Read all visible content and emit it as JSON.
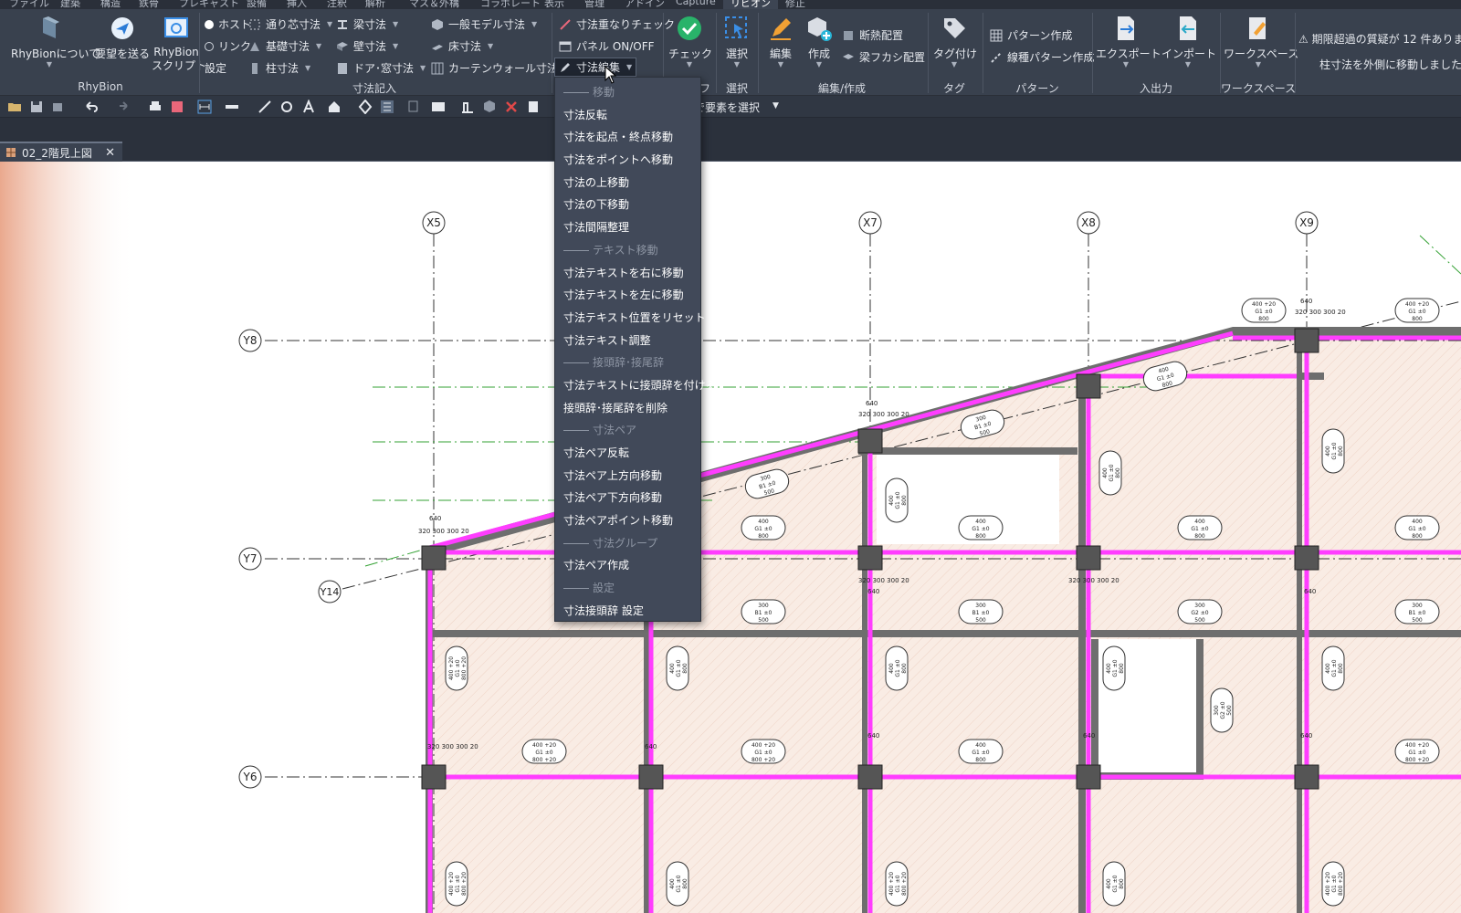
{
  "menu": [
    "ファイル",
    "建築",
    "構造",
    "鉄骨",
    "プレキャスト",
    "設備",
    "挿入",
    "注釈",
    "解析",
    "マス＆外構",
    "コラボレート",
    "表示",
    "管理",
    "アドイン",
    "Capture",
    "リビオン",
    "修正"
  ],
  "ribbon": {
    "rhybion": {
      "about": "RhyBionについて",
      "feedback": "要望を送る",
      "script_line1": "RhyBion",
      "script_line2": "スクリプト",
      "group": "RhyBion"
    },
    "dims": {
      "host": "ホスト",
      "link": "リンク",
      "setting": "設定",
      "grid_dim": "通り芯寸法",
      "found_dim": "基礎寸法",
      "col_dim": "柱寸法",
      "beam_dim": "梁寸法",
      "wall_dim": "壁寸法",
      "door_dim": "ドア･窓寸法",
      "model_dim": "一般モデル寸法",
      "floor_dim": "床寸法",
      "cw_dim": "カーテンウォール寸法",
      "group": "寸法記入"
    },
    "check_tools": {
      "overlap": "寸法重なりチェック",
      "panel": "パネル ON/OFF",
      "edit": "寸法編集",
      "group_tail": "フ"
    },
    "check": {
      "label": "チェック"
    },
    "select": {
      "label": "選択",
      "group": "選択"
    },
    "edit_create": {
      "edit": "編集",
      "create": "作成",
      "insulation": "断熱配置",
      "haunch": "梁フカシ配置",
      "group": "編集/作成"
    },
    "tag": {
      "label": "タグ付け",
      "group": "タグ"
    },
    "pattern": {
      "create": "パターン作成",
      "line": "線種パターン作成",
      "group": "パターン"
    },
    "io": {
      "export": "エクスポート",
      "import": "インポート",
      "group": "入出力"
    },
    "workspace": {
      "label": "ワークスペース",
      "group": "ワークスペース"
    }
  },
  "notice": {
    "line1": "⚠ 期限超過の質疑が 12 件あります",
    "line2": "柱寸法を外側に移動しました。反"
  },
  "qat": {
    "select_text": "で要素を選択"
  },
  "doc_tab": {
    "name": "02_2階見上図",
    "close": "✕"
  },
  "dropdown": [
    {
      "type": "section",
      "label": "移動"
    },
    {
      "type": "item",
      "label": "寸法反転"
    },
    {
      "type": "item",
      "label": "寸法を起点・終点移動"
    },
    {
      "type": "item",
      "label": "寸法をポイントへ移動"
    },
    {
      "type": "item",
      "label": "寸法の上移動"
    },
    {
      "type": "item",
      "label": "寸法の下移動"
    },
    {
      "type": "item",
      "label": "寸法間隔整理"
    },
    {
      "type": "section",
      "label": "テキスト移動"
    },
    {
      "type": "item",
      "label": "寸法テキストを右に移動"
    },
    {
      "type": "item",
      "label": "寸法テキストを左に移動"
    },
    {
      "type": "item",
      "label": "寸法テキスト位置をリセット"
    },
    {
      "type": "item",
      "label": "寸法テキスト調整"
    },
    {
      "type": "section",
      "label": "接頭辞･接尾辞"
    },
    {
      "type": "item",
      "label": "寸法テキストに接頭辞を付ける"
    },
    {
      "type": "item",
      "label": "接頭辞･接尾辞を削除"
    },
    {
      "type": "section",
      "label": "寸法ペア"
    },
    {
      "type": "item",
      "label": "寸法ペア反転"
    },
    {
      "type": "item",
      "label": "寸法ペア上方向移動"
    },
    {
      "type": "item",
      "label": "寸法ペア下方向移動"
    },
    {
      "type": "item",
      "label": "寸法ペアポイント移動"
    },
    {
      "type": "section",
      "label": "寸法グループ"
    },
    {
      "type": "item",
      "label": "寸法ペア作成"
    },
    {
      "type": "section",
      "label": "設定"
    },
    {
      "type": "item",
      "label": "寸法接頭辞 設定"
    }
  ],
  "drawing": {
    "grid_x": [
      "X5",
      "X7",
      "X8",
      "X9"
    ],
    "grid_y": [
      "Y8",
      "Y7",
      "Y6"
    ],
    "grid_other": [
      "Y14"
    ],
    "beam_tags": [
      {
        "lines": [
          "400",
          "G1  ±0",
          "800"
        ]
      },
      {
        "lines": [
          "300",
          "B1  ±0",
          "500"
        ]
      },
      {
        "lines": [
          "400 +20",
          "G1  ±0",
          "800 +20"
        ]
      },
      {
        "lines": [
          "300",
          "G2  ±0",
          "500"
        ]
      }
    ],
    "col_dims": [
      "640",
      "320 300 300 20",
      "20 375 375 20"
    ],
    "colors": {
      "beam": "#ff3dff",
      "wall": "#6e6e6e",
      "slab": "#f9ece4",
      "grid": "#222222",
      "green": "#33a133"
    }
  }
}
